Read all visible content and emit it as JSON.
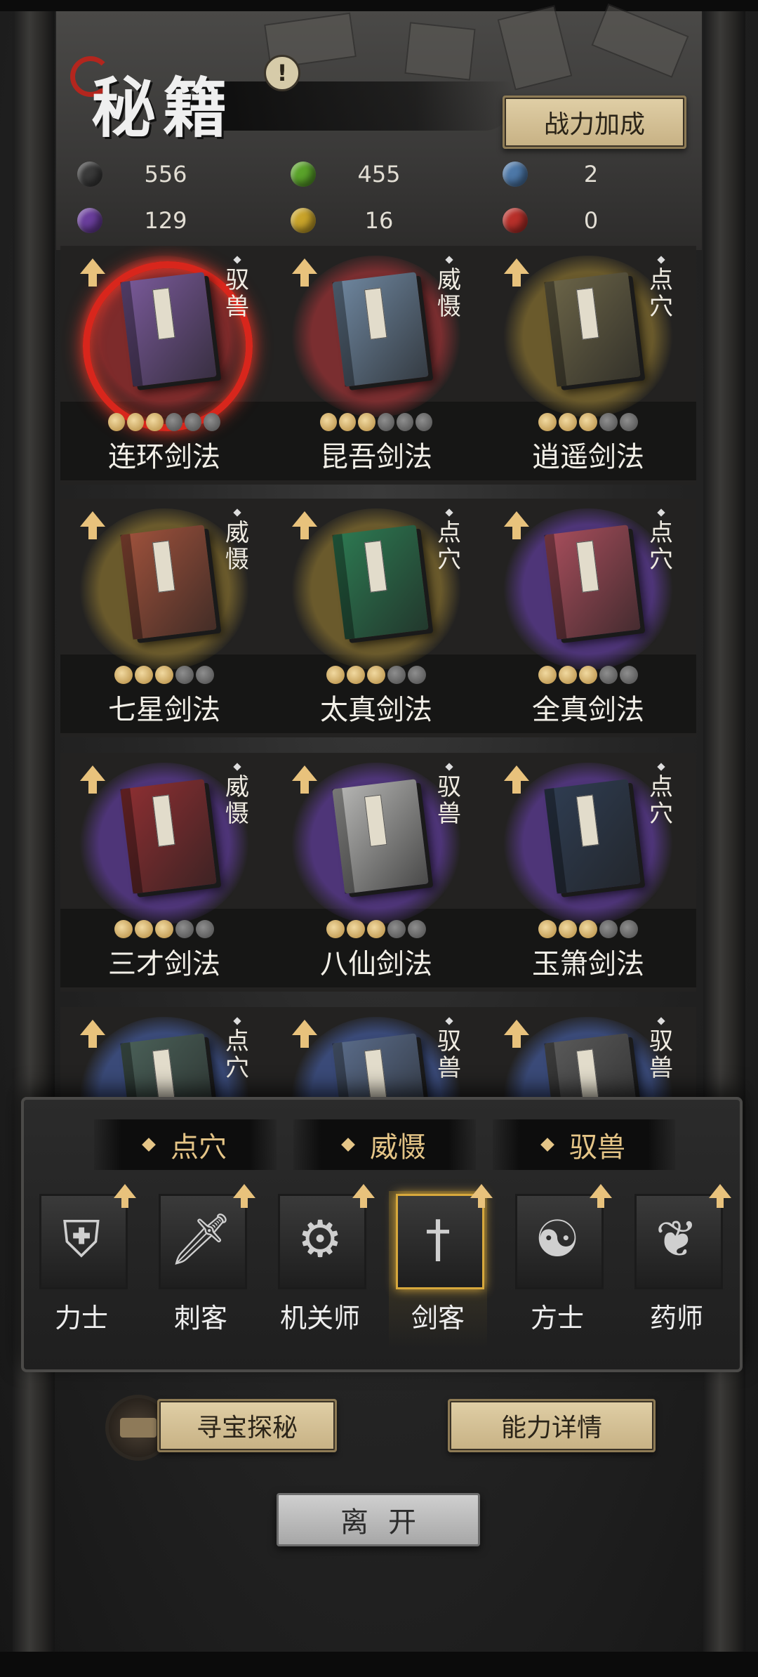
{
  "header": {
    "title": "秘籍",
    "alert_glyph": "!",
    "power_button": "战力加成"
  },
  "resources": [
    {
      "orb": "black-orb",
      "color": "#3a3a3a",
      "value": "556"
    },
    {
      "orb": "green-orb",
      "color": "#5aa32a",
      "value": "455"
    },
    {
      "orb": "blue-orb",
      "color": "#4d78a8",
      "value": "2"
    },
    {
      "orb": "purple-orb",
      "color": "#6a3e9c",
      "value": "129"
    },
    {
      "orb": "gold-orb",
      "color": "#c9a42a",
      "value": "16"
    },
    {
      "orb": "red-orb",
      "color": "#b8302a",
      "value": "0"
    }
  ],
  "skills": [
    {
      "name": "连环剑法",
      "tag": "驭兽",
      "rarity": "red",
      "aura": "#7d2b2b",
      "book": "#7a5a9a",
      "on": 3,
      "total": 6,
      "selected": true
    },
    {
      "name": "昆吾剑法",
      "tag": "威慑",
      "rarity": "red",
      "aura": "#7a2e30",
      "book": "#6f87a0",
      "on": 3,
      "total": 6,
      "selected": false
    },
    {
      "name": "逍遥剑法",
      "tag": "点穴",
      "rarity": "gold",
      "aura": "#6a5a2c",
      "book": "#6c6548",
      "on": 3,
      "total": 5,
      "selected": false
    },
    {
      "name": "七星剑法",
      "tag": "威慑",
      "rarity": "gold",
      "aura": "#6a5a2c",
      "book": "#a0523c",
      "on": 3,
      "total": 5,
      "selected": false
    },
    {
      "name": "太真剑法",
      "tag": "点穴",
      "rarity": "gold",
      "aura": "#6a5a2c",
      "book": "#2d7a52",
      "on": 3,
      "total": 5,
      "selected": false
    },
    {
      "name": "全真剑法",
      "tag": "点穴",
      "rarity": "purple",
      "aura": "#4e3578",
      "book": "#a84e5c",
      "on": 3,
      "total": 5,
      "selected": false
    },
    {
      "name": "三才剑法",
      "tag": "威慑",
      "rarity": "purple",
      "aura": "#4e3578",
      "book": "#8e2f32",
      "on": 3,
      "total": 5,
      "selected": false
    },
    {
      "name": "八仙剑法",
      "tag": "驭兽",
      "rarity": "purple",
      "aura": "#4e3578",
      "book": "#b8b8b6",
      "on": 3,
      "total": 5,
      "selected": false
    },
    {
      "name": "玉箫剑法",
      "tag": "点穴",
      "rarity": "purple",
      "aura": "#4e3578",
      "book": "#2f3d52",
      "on": 3,
      "total": 5,
      "selected": false
    },
    {
      "name": "",
      "tag": "点穴",
      "rarity": "blue",
      "aura": "#3a4a78",
      "book": "#4a6058",
      "on": 0,
      "total": 0,
      "selected": false
    },
    {
      "name": "",
      "tag": "驭兽",
      "rarity": "blue",
      "aura": "#3a4a78",
      "book": "#5a6c8a",
      "on": 0,
      "total": 0,
      "selected": false
    },
    {
      "name": "",
      "tag": "驭兽",
      "rarity": "blue",
      "aura": "#3a4a78",
      "book": "#5a5a5a",
      "on": 0,
      "total": 0,
      "selected": false
    }
  ],
  "filters": [
    "点穴",
    "威慑",
    "驭兽"
  ],
  "classes": [
    {
      "name": "力士",
      "icon": "helmet-icon",
      "glyph": "⛨",
      "selected": false
    },
    {
      "name": "刺客",
      "icon": "dagger-icon",
      "glyph": "🗡",
      "selected": false
    },
    {
      "name": "机关师",
      "icon": "gears-icon",
      "glyph": "⚙",
      "selected": false
    },
    {
      "name": "剑客",
      "icon": "sword-icon",
      "glyph": "†",
      "selected": true
    },
    {
      "name": "方士",
      "icon": "yin-yang-icon",
      "glyph": "☯",
      "selected": false
    },
    {
      "name": "药师",
      "icon": "gourd-icon",
      "glyph": "❦",
      "selected": false
    }
  ],
  "actions": {
    "treasure_hunt": "寻宝探秘",
    "ability_details": "能力详情",
    "leave": "离开"
  }
}
